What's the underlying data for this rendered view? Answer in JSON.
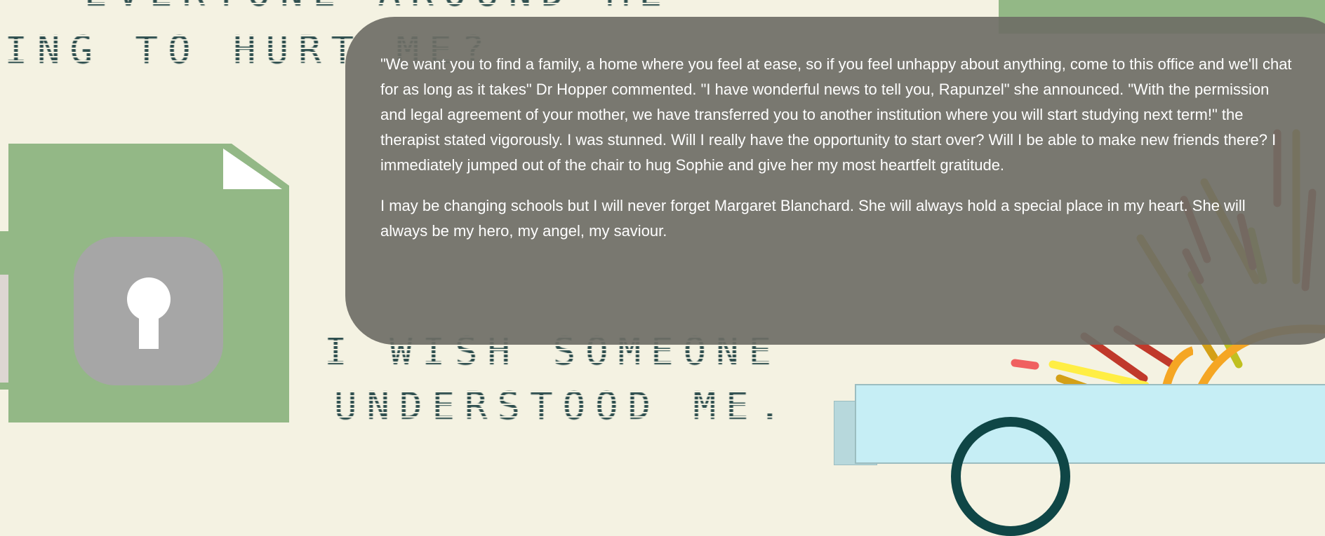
{
  "background_text": {
    "line_top": "EVERYONE AROUND ME",
    "line_1": "YING TO HURT ME?",
    "line_2": "I WISH SOMEONE",
    "line_3": "UNDERSTOOD ME."
  },
  "dialog": {
    "paragraphs": [
      "\"We want you to find a family, a home where you feel at ease, so if you feel unhappy about anything, come to this office and we'll chat for as long as it takes\" Dr Hopper commented. \"I have wonderful news to tell you, Rapunzel\" she announced. \"With the permission and legal agreement of your mother, we have transferred you to another institution where you will start studying next term!\" the therapist stated vigorously. I was stunned. Will I really have the opportunity to start over? Will I be able to make new friends there? I immediately jumped out of the chair to hug Sophie and give her my most heartfelt gratitude.",
      "I may be changing schools but I will never forget Margaret Blanchard. She will always hold a special place in my heart. She will always be my hero, my angel, my saviour."
    ]
  },
  "colors": {
    "background": "#f4f2e2",
    "document_green": "#93b886",
    "lock_gray": "#a6a6a6",
    "dialog_bg": "#6e6e66",
    "card_blue": "#c6eef5",
    "pixel_text": "#2f4f4f"
  },
  "icons": {
    "document": "locked-document-icon",
    "lock": "keyhole-icon",
    "sunburst": "sunburst-decoration",
    "logo": "circle-logo-icon"
  }
}
